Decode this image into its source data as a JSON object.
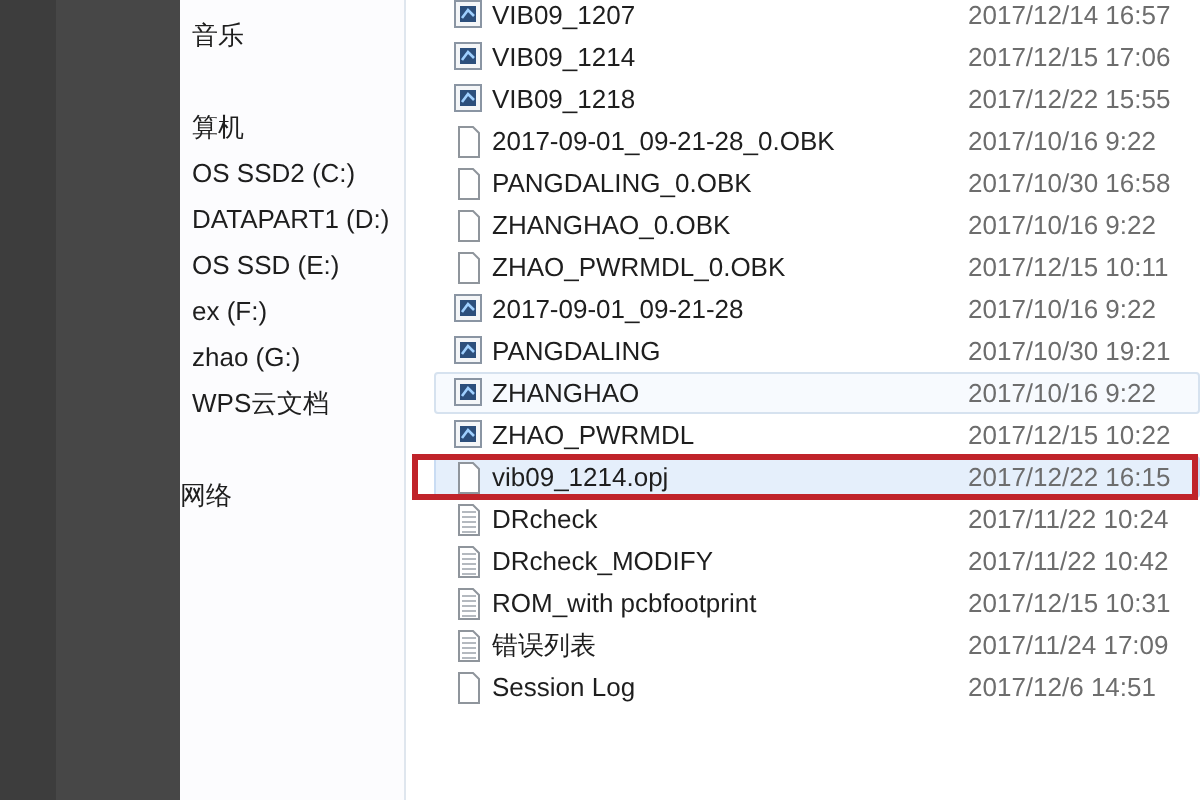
{
  "sidebar": {
    "groups": [
      {
        "label": "音乐"
      },
      {
        "label": "算机",
        "children": [
          {
            "label": "OS SSD2 (C:)"
          },
          {
            "label": "DATAPART1 (D:)"
          },
          {
            "label": "OS SSD (E:)"
          },
          {
            "label": "ex (F:)"
          },
          {
            "label": "zhao (G:)"
          },
          {
            "label": "WPS云文档"
          }
        ]
      },
      {
        "label": "网络"
      }
    ]
  },
  "files": [
    {
      "name": "VIB09_1207",
      "modified": "2017/12/14 16:57",
      "kind": "app",
      "hovered": false,
      "selected": false,
      "annotated": false
    },
    {
      "name": "VIB09_1214",
      "modified": "2017/12/15 17:06",
      "kind": "app",
      "hovered": false,
      "selected": false,
      "annotated": false
    },
    {
      "name": "VIB09_1218",
      "modified": "2017/12/22 15:55",
      "kind": "app",
      "hovered": false,
      "selected": false,
      "annotated": false
    },
    {
      "name": "2017-09-01_09-21-28_0.OBK",
      "modified": "2017/10/16 9:22",
      "kind": "blank",
      "hovered": false,
      "selected": false,
      "annotated": false
    },
    {
      "name": "PANGDALING_0.OBK",
      "modified": "2017/10/30 16:58",
      "kind": "blank",
      "hovered": false,
      "selected": false,
      "annotated": false
    },
    {
      "name": "ZHANGHAO_0.OBK",
      "modified": "2017/10/16 9:22",
      "kind": "blank",
      "hovered": false,
      "selected": false,
      "annotated": false
    },
    {
      "name": "ZHAO_PWRMDL_0.OBK",
      "modified": "2017/12/15 10:11",
      "kind": "blank",
      "hovered": false,
      "selected": false,
      "annotated": false
    },
    {
      "name": "2017-09-01_09-21-28",
      "modified": "2017/10/16 9:22",
      "kind": "app",
      "hovered": false,
      "selected": false,
      "annotated": false
    },
    {
      "name": "PANGDALING",
      "modified": "2017/10/30 19:21",
      "kind": "app",
      "hovered": false,
      "selected": false,
      "annotated": false
    },
    {
      "name": "ZHANGHAO",
      "modified": "2017/10/16 9:22",
      "kind": "app",
      "hovered": true,
      "selected": false,
      "annotated": false
    },
    {
      "name": "ZHAO_PWRMDL",
      "modified": "2017/12/15 10:22",
      "kind": "app",
      "hovered": false,
      "selected": false,
      "annotated": false
    },
    {
      "name": "vib09_1214.opj",
      "modified": "2017/12/22 16:15",
      "kind": "blank",
      "hovered": false,
      "selected": true,
      "annotated": true
    },
    {
      "name": "DRcheck",
      "modified": "2017/11/22 10:24",
      "kind": "text",
      "hovered": false,
      "selected": false,
      "annotated": false
    },
    {
      "name": "DRcheck_MODIFY",
      "modified": "2017/11/22 10:42",
      "kind": "text",
      "hovered": false,
      "selected": false,
      "annotated": false
    },
    {
      "name": "ROM_with pcbfootprint",
      "modified": "2017/12/15 10:31",
      "kind": "text",
      "hovered": false,
      "selected": false,
      "annotated": false
    },
    {
      "name": "错误列表",
      "modified": "2017/11/24 17:09",
      "kind": "text",
      "hovered": false,
      "selected": false,
      "annotated": false
    },
    {
      "name": "Session Log",
      "modified": "2017/12/6 14:51",
      "kind": "blank",
      "hovered": false,
      "selected": false,
      "annotated": false
    }
  ]
}
